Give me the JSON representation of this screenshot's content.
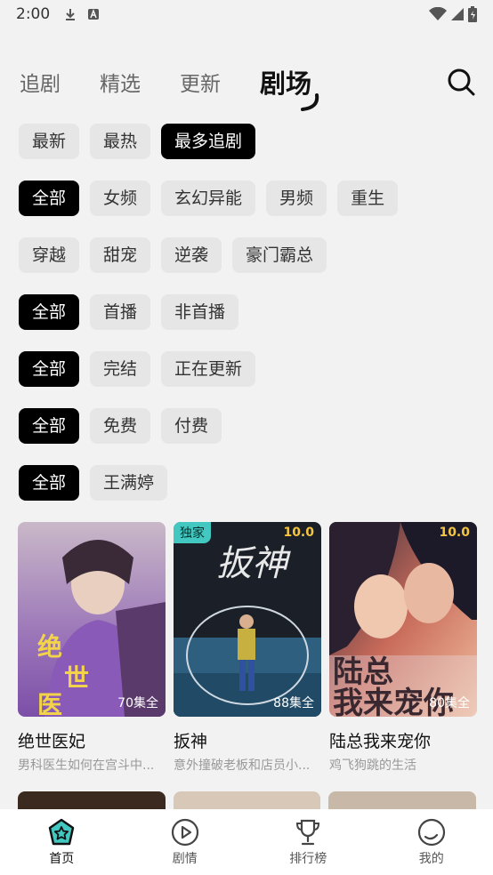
{
  "status_bar": {
    "time": "2:00"
  },
  "top_tabs": [
    {
      "label": "追剧",
      "active": false
    },
    {
      "label": "精选",
      "active": false
    },
    {
      "label": "更新",
      "active": false
    },
    {
      "label": "剧场",
      "active": true
    }
  ],
  "filters": {
    "sort": [
      "最新",
      "最热",
      "最多追剧"
    ],
    "genre_row1": [
      "全部",
      "女频",
      "玄幻异能",
      "男频",
      "重生"
    ],
    "genre_row2": [
      "穿越",
      "甜宠",
      "逆袭",
      "豪门霸总"
    ],
    "premiere": [
      "全部",
      "首播",
      "非首播"
    ],
    "status": [
      "全部",
      "完结",
      "正在更新"
    ],
    "price": [
      "全部",
      "免费",
      "付费"
    ],
    "actor": [
      "全部",
      "王满婷"
    ]
  },
  "cards": [
    {
      "title": "绝世医妃",
      "desc": "男科医生如何在宫斗中...",
      "episodes": "70集全",
      "score": "",
      "badge": "",
      "poster_text": "绝世医"
    },
    {
      "title": "扳神",
      "desc": "意外撞破老板和店员小...",
      "episodes": "88集全",
      "score": "10.0",
      "badge": "独家",
      "poster_text": "扳神"
    },
    {
      "title": "陆总我来宠你",
      "desc": "鸡飞狗跳的生活",
      "episodes": "80集全",
      "score": "10.0",
      "badge": "",
      "poster_text": "陆总我来宠你"
    }
  ],
  "bottom_nav": [
    {
      "label": "首页",
      "icon": "home-star-icon",
      "active": true
    },
    {
      "label": "剧情",
      "icon": "play-circle-icon",
      "active": false
    },
    {
      "label": "排行榜",
      "icon": "trophy-icon",
      "active": false
    },
    {
      "label": "我的",
      "icon": "profile-icon",
      "active": false
    }
  ],
  "colors": {
    "accent_teal": "#42c8c0",
    "score_gold": "#f4c542",
    "chip_selected": "#000000",
    "chip_default": "#e6e6e6"
  }
}
